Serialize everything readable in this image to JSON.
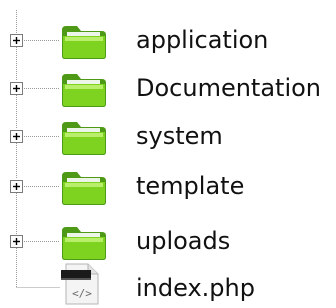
{
  "tree": {
    "items": [
      {
        "label": "application",
        "type": "folder",
        "icon": "folder-icon",
        "expander": "plus"
      },
      {
        "label": "Documentation",
        "type": "folder",
        "icon": "folder-icon",
        "expander": "plus"
      },
      {
        "label": "system",
        "type": "folder",
        "icon": "folder-icon",
        "expander": "plus"
      },
      {
        "label": "template",
        "type": "folder",
        "icon": "folder-icon",
        "expander": "plus"
      },
      {
        "label": "uploads",
        "type": "folder",
        "icon": "folder-icon",
        "expander": "plus"
      },
      {
        "label": "index.php",
        "type": "file",
        "icon": "php-file-icon",
        "expander": "none"
      }
    ]
  },
  "colors": {
    "folder_fill": "#7ED321",
    "folder_dark": "#4E9A16",
    "folder_light": "#B9EE6B",
    "line": "#9A9A9A",
    "expander_border": "#7A7A7A",
    "text": "#111111"
  }
}
